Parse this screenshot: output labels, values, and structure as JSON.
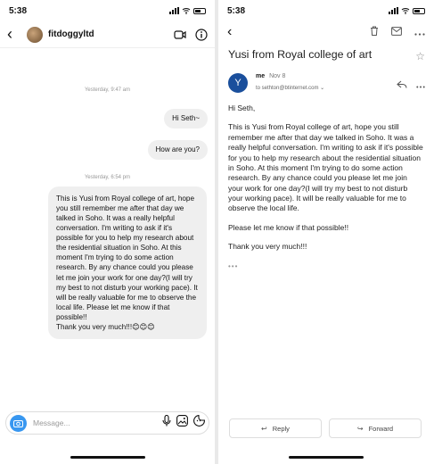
{
  "left": {
    "status_time": "5:38",
    "header": {
      "back": "‹",
      "username": "fitdoggyltd"
    },
    "messages": [
      {
        "type": "timestamp",
        "text": "Yesterday, 9:47 am"
      },
      {
        "type": "outgoing",
        "text": "Hi Seth~"
      },
      {
        "type": "outgoing",
        "text": "How are you?"
      },
      {
        "type": "timestamp",
        "text": "Yesterday, 6:54 pm"
      },
      {
        "type": "incoming",
        "text": "This is Yusi from Royal college of art, hope you still remember me after that day we talked in Soho. It was a really helpful conversation. I'm writing to ask if it's possible for you to help my research about the residential situation in Soho. At this moment I'm trying to do some action research. By any chance could you please let me join your work for one day?(I will try my best to not disturb your working pace). It will be really valuable for me to observe the local life. Please let me know if that possible!!"
      },
      {
        "type": "incoming_tail",
        "text": "Thank you very much!!!😊😊😊"
      }
    ],
    "composer": {
      "placeholder": "Message..."
    }
  },
  "right": {
    "status_time": "5:38",
    "subject": "Yusi from Royal college of art",
    "sender": {
      "avatar_letter": "Y",
      "from": "me",
      "date": "Nov 8",
      "to": "to sethton@btinternet.com",
      "avatar_color": "#1a4f9c"
    },
    "body": {
      "greeting": "Hi Seth,",
      "paragraph": "This is Yusi from Royal college of art, hope you still remember me after that day we talked in Soho. It was a really helpful conversation. I'm writing to ask if it's possible for you to help my research about the residential situation in Soho. At this moment I'm trying to do some action research. By any chance could you please let me join your work for one day?(I will try my best to not disturb your working pace). It will be really valuable for me to observe the local life.",
      "request": "Please let me know if that possible!!",
      "thanks": "Thank you very much!!!",
      "ellipsis": "•••"
    },
    "buttons": {
      "reply": "Reply",
      "forward": "Forward"
    }
  }
}
